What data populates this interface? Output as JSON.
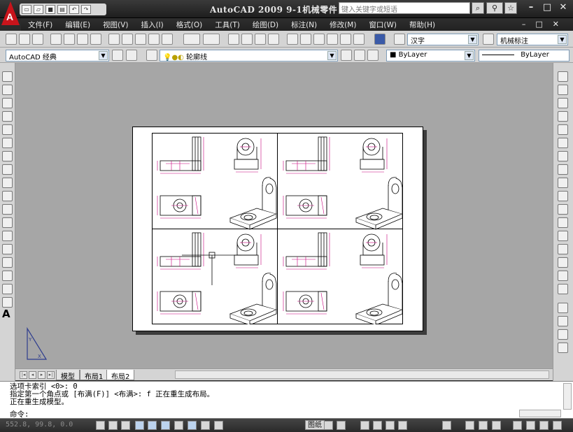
{
  "title_bar": {
    "title": "AutoCAD 2009  9-1机械零件",
    "search_placeholder": "键入关键字或短语",
    "logo_letter": "A",
    "window_controls": [
      "minimize-icon",
      "restore-icon",
      "close-icon"
    ]
  },
  "menu": {
    "items": [
      "文件(F)",
      "编辑(E)",
      "视图(V)",
      "插入(I)",
      "格式(O)",
      "工具(T)",
      "绘图(D)",
      "标注(N)",
      "修改(M)",
      "窗口(W)",
      "帮助(H)"
    ]
  },
  "toolbars": {
    "text_style": "汉字",
    "dim_style": "机械标注",
    "workspace": "AutoCAD 经典",
    "layer": "轮廓线",
    "color": "ByLayer",
    "linetype": "ByLayer"
  },
  "layout_tabs": [
    "模型",
    "布局1",
    "布局2"
  ],
  "active_tab": "布局2",
  "command": {
    "history": [
      "选项卡索引 <0>: 0",
      "指定第一个角点或 [布满(F)] <布满>: f 正在重生成布局。",
      "正在重生成模型。"
    ],
    "prompt": "命令:"
  },
  "status": {
    "coordinates": "552.8, 99.8, 0.0",
    "paper_label": "图纸"
  },
  "colors": {
    "titlebar": "#2a2a2a",
    "canvas": "#a6a6a6",
    "paper": "#ffffff",
    "dimension": "#c8007a",
    "logo": "#c8141b"
  }
}
